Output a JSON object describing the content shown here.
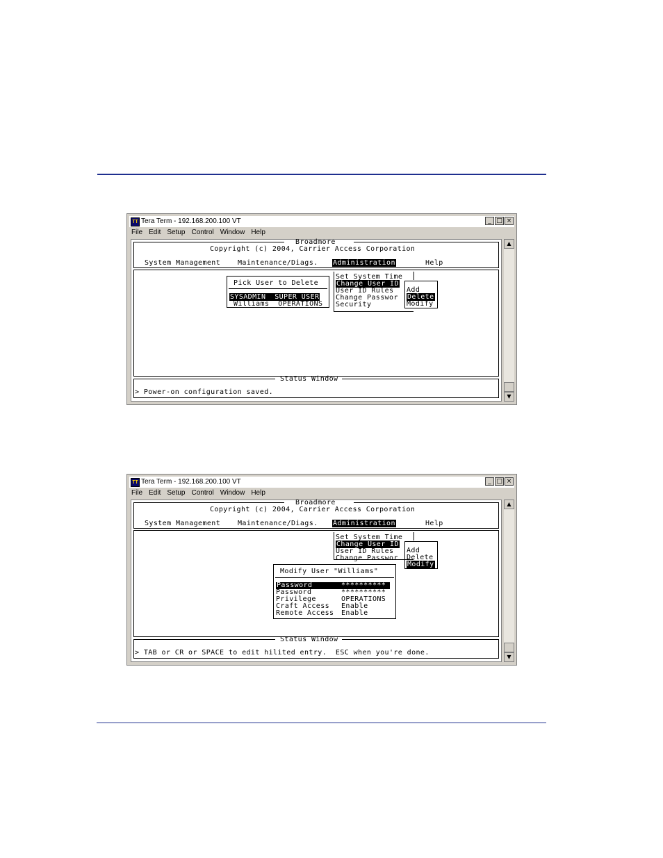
{
  "window": {
    "title": "Tera Term - 192.168.200.100 VT",
    "controls": {
      "minimize": "_",
      "maximize": "□",
      "close": "×"
    },
    "menu": [
      "File",
      "Edit",
      "Setup",
      "Control",
      "Window",
      "Help"
    ]
  },
  "terminal": {
    "title": "Broadmore",
    "copyright": "Copyright (c) 2004, Carrier Access Corporation",
    "main_menu": [
      "System Management",
      "Maintenance/Diags.",
      "Administration",
      "Help"
    ],
    "admin_menu": [
      "Set System Time",
      "Change User ID",
      "User ID Rules",
      "Change Passwor",
      "Security"
    ],
    "user_id_menu": [
      "Add",
      "Delete",
      "Modify"
    ],
    "status_label": "Status Window"
  },
  "screen1": {
    "picker_title": "Pick User to Delete",
    "users": [
      {
        "name": "SYSADMIN",
        "role": "SUPER USER"
      },
      {
        "name": "Williams",
        "role": "OPERATIONS"
      }
    ],
    "status_message": "> Power-on configuration saved."
  },
  "screen2": {
    "dialog_title": "Modify User \"Williams\"",
    "fields": [
      {
        "label": "Password",
        "value": "**********"
      },
      {
        "label": "Password",
        "value": "**********"
      },
      {
        "label": "Privilege",
        "value": "OPERATIONS"
      },
      {
        "label": "Craft Access",
        "value": "Enable"
      },
      {
        "label": "Remote Access",
        "value": "Enable"
      }
    ],
    "status_message": "> TAB or CR or SPACE to edit hilited entry.  ESC when you're done."
  },
  "icons": {
    "app": "tera-term-app-icon",
    "scroll_up": "▲",
    "scroll_down": "▼"
  },
  "colors": {
    "rule": "#1f2f8f",
    "window_chrome": "#d4d0c8",
    "highlight": "#000000"
  }
}
